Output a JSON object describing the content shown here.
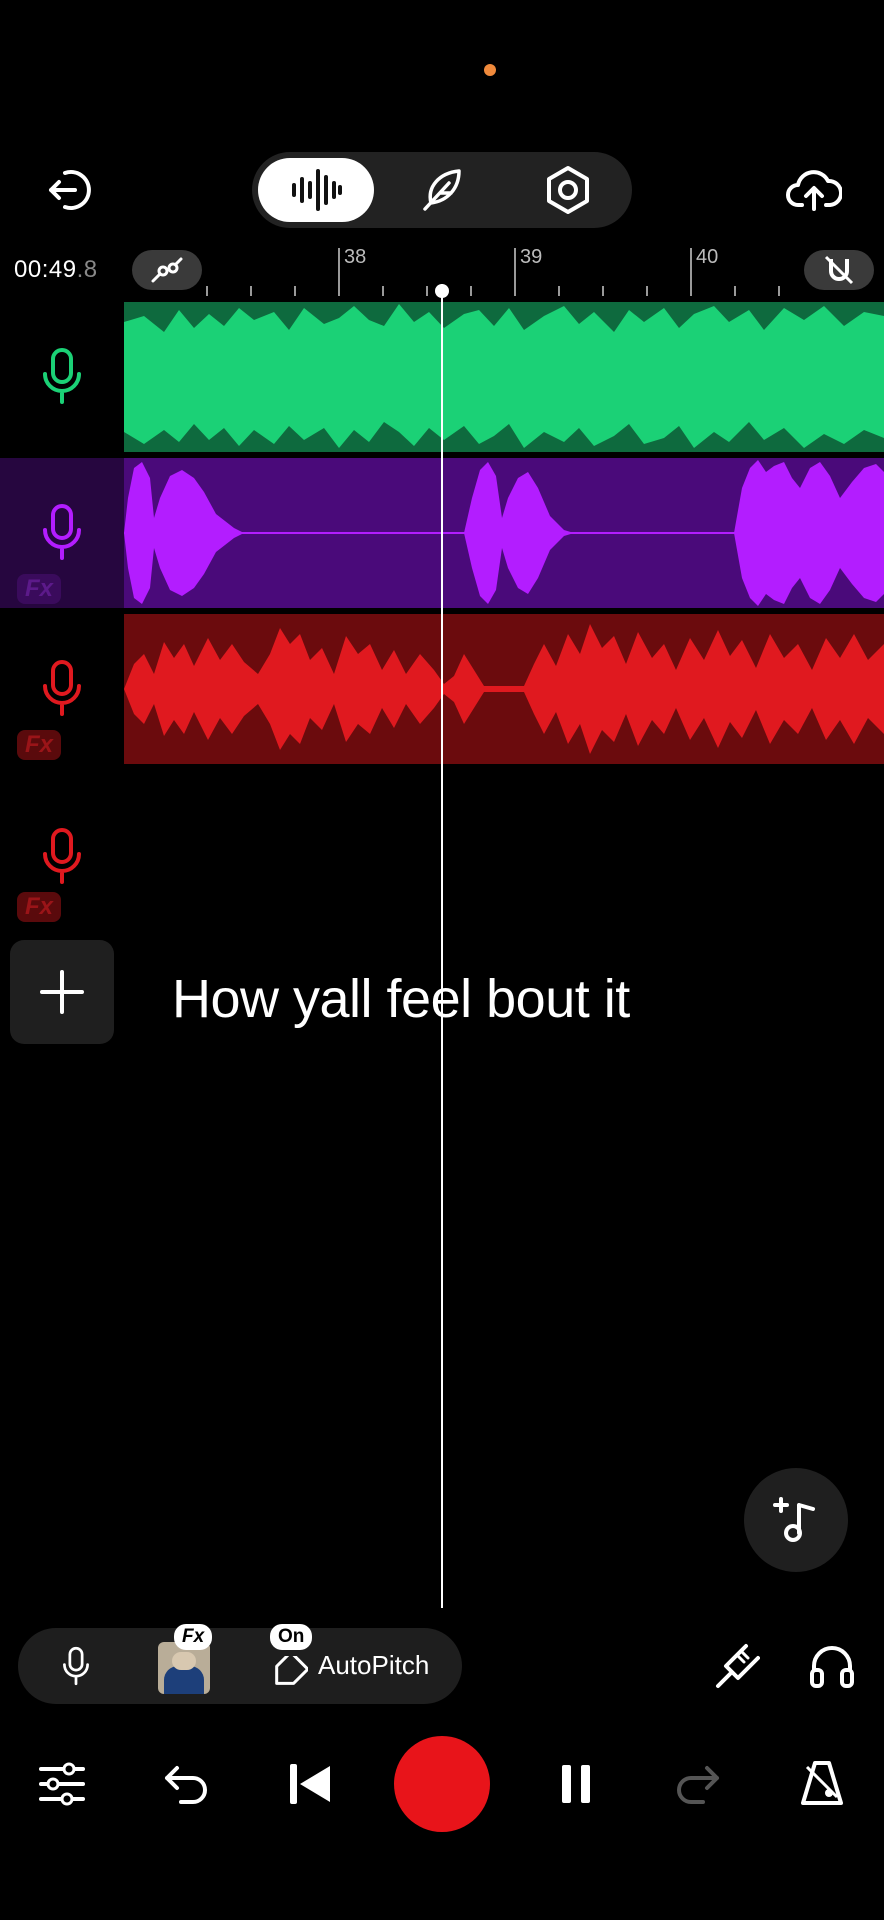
{
  "status": {
    "recording_dot_color": "#f08a3c"
  },
  "header": {
    "exit_icon": "exit-icon",
    "tabs": [
      {
        "name": "waveform-tab",
        "icon": "waveform-icon",
        "active": true
      },
      {
        "name": "lyrics-tab",
        "icon": "feather-icon",
        "active": false
      },
      {
        "name": "settings-tab",
        "icon": "hex-nut-icon",
        "active": false
      }
    ],
    "upload_icon": "cloud-upload-icon"
  },
  "timeline": {
    "time_main": "00:49",
    "time_fraction": ".8",
    "ruler_labels": [
      "38",
      "39",
      "40"
    ]
  },
  "tracks": [
    {
      "name": "track-1",
      "color": "#1bd176",
      "bg": "#0e6a3e",
      "fx": false
    },
    {
      "name": "track-2",
      "color": "#b31dff",
      "bg": "#4a0a7a",
      "fx": true
    },
    {
      "name": "track-3",
      "color": "#e0191f",
      "bg": "#6b0b0d",
      "fx": true
    },
    {
      "name": "track-4",
      "color": "#e0191f",
      "bg": null,
      "fx": true
    }
  ],
  "fx_label": "Fx",
  "caption": "How yall feel bout it",
  "bottom_bar": {
    "fx_badge": "Fx",
    "autopitch_badge": "On",
    "autopitch_label": "AutoPitch"
  }
}
